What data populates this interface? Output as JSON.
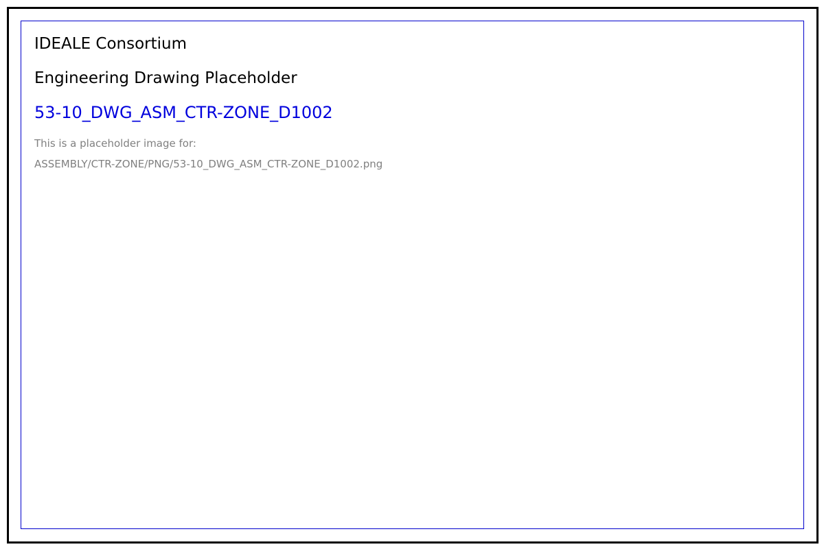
{
  "document": {
    "organization": "IDEALE Consortium",
    "subtitle": "Engineering Drawing Placeholder",
    "drawing_id": "53-10_DWG_ASM_CTR-ZONE_D1002",
    "note": "This is a placeholder image for:",
    "file_path": "ASSEMBLY/CTR-ZONE/PNG/53-10_DWG_ASM_CTR-ZONE_D1002.png"
  },
  "colors": {
    "outer_border": "#000000",
    "inner_border": "#0000cc",
    "drawing_id_text": "#0000dd",
    "note_text": "#808080"
  }
}
